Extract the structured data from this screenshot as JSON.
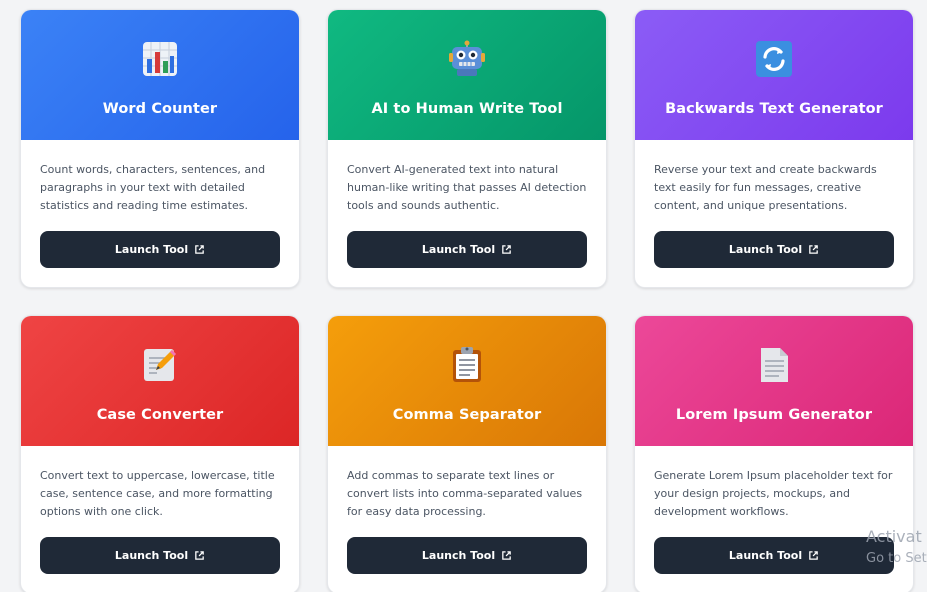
{
  "cards": [
    {
      "title": "Word Counter",
      "description": "Count words, characters, sentences, and paragraphs in your text with detailed statistics and reading time estimates.",
      "button": "Launch Tool",
      "icon": "bar-chart-icon",
      "gradient": [
        "#3b82f6",
        "#2563eb"
      ]
    },
    {
      "title": "AI to Human Write Tool",
      "description": "Convert AI-generated text into natural human-like writing that passes AI detection tools and sounds authentic.",
      "button": "Launch Tool",
      "icon": "robot-icon",
      "gradient": [
        "#10b981",
        "#059669"
      ]
    },
    {
      "title": "Backwards Text Generator",
      "description": "Reverse your text and create backwards text easily for fun messages, creative content, and unique presentations.",
      "button": "Launch Tool",
      "icon": "refresh-icon",
      "gradient": [
        "#8b5cf6",
        "#7c3aed"
      ]
    },
    {
      "title": "Case Converter",
      "description": "Convert text to uppercase, lowercase, title case, sentence case, and more formatting options with one click.",
      "button": "Launch Tool",
      "icon": "memo-pencil-icon",
      "gradient": [
        "#ef4444",
        "#dc2626"
      ]
    },
    {
      "title": "Comma Separator",
      "description": "Add commas to separate text lines or convert lists into comma-separated values for easy data processing.",
      "button": "Launch Tool",
      "icon": "clipboard-icon",
      "gradient": [
        "#f59e0b",
        "#d97706"
      ]
    },
    {
      "title": "Lorem Ipsum Generator",
      "description": "Generate Lorem Ipsum placeholder text for your design projects, mockups, and development workflows.",
      "button": "Launch Tool",
      "icon": "document-icon",
      "gradient": [
        "#ec4899",
        "#db2777"
      ]
    }
  ],
  "watermark": {
    "line1": "Activat",
    "line2": "Go to Set"
  }
}
